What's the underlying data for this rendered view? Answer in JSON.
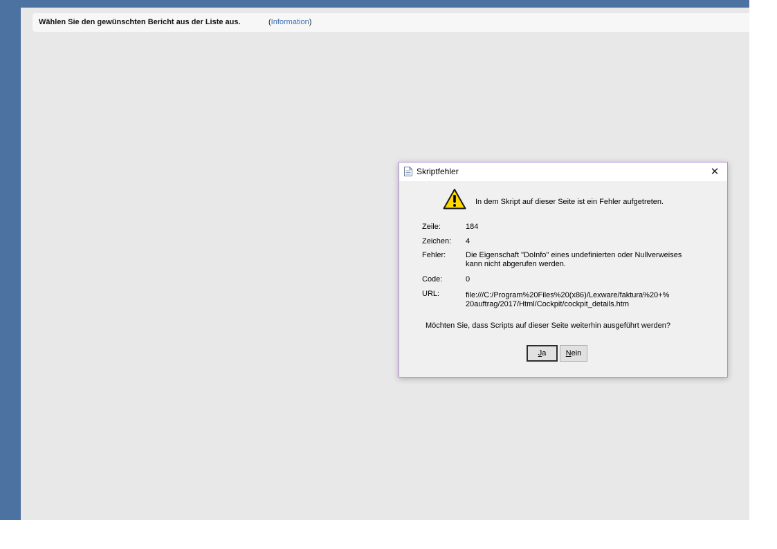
{
  "infobar": {
    "message": "Wählen Sie den gewünschten Bericht aus der Liste aus.",
    "link_open": "(",
    "link_text": "Information",
    "link_close": ")"
  },
  "dialog": {
    "title": "Skriptfehler",
    "close_glyph": "✕",
    "headline": "In dem Skript auf dieser Seite ist ein Fehler aufgetreten.",
    "fields": {
      "line": {
        "label": "Zeile:",
        "value": "184"
      },
      "char": {
        "label": "Zeichen:",
        "value": "4"
      },
      "error": {
        "label": "Fehler:",
        "value_line1": "Die Eigenschaft \"DoInfo\" eines undefinierten oder Nullverweises",
        "value_line2": "kann nicht abgerufen werden."
      },
      "code": {
        "label": "Code:",
        "value": "0"
      },
      "url": {
        "label": "URL:",
        "value_line1": "file:///C:/Program%20Files%20(x86)/Lexware/faktura%20+%",
        "value_line2": "20auftrag/2017/Html/Cockpit/cockpit_details.htm"
      }
    },
    "question": "Möchten Sie, dass Scripts auf dieser Seite weiterhin ausgeführt werden?",
    "buttons": {
      "yes": {
        "mnemonic": "J",
        "rest": "a"
      },
      "no": {
        "mnemonic": "N",
        "rest": "ein"
      }
    }
  },
  "colors": {
    "rail": "#4b72a0",
    "background": "#e8e8e8",
    "dialog_border": "#b48ad8",
    "link": "#3a6fb0",
    "warning": "#ffd800"
  },
  "icons": {
    "title_icon": "document-icon",
    "warning_icon": "warning-icon",
    "close_icon": "close-icon"
  }
}
